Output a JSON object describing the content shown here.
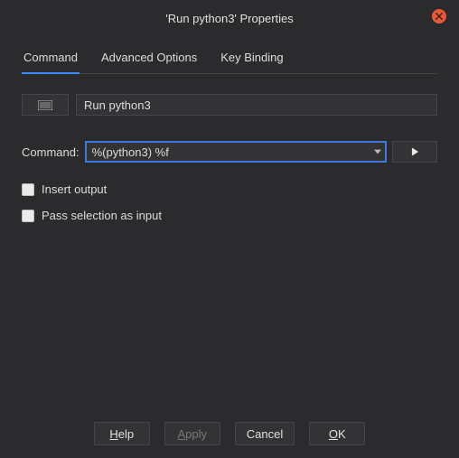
{
  "window": {
    "title": "'Run python3' Properties"
  },
  "tabs": {
    "command": "Command",
    "advanced": "Advanced Options",
    "keybinding": "Key Binding"
  },
  "name": {
    "value": "Run python3"
  },
  "command": {
    "label": "Command:",
    "value": "%(python3) %f"
  },
  "checks": {
    "insert_output": "Insert output",
    "pass_selection": "Pass selection as input"
  },
  "buttons": {
    "help": "Help",
    "apply": "Apply",
    "cancel": "Cancel",
    "ok": "OK"
  }
}
